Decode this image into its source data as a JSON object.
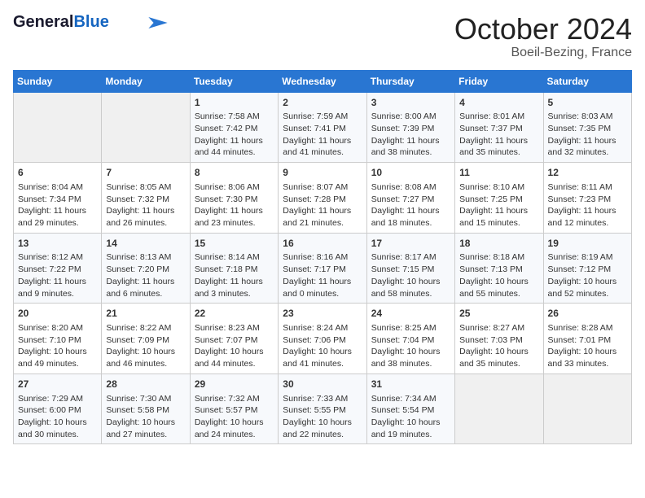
{
  "header": {
    "logo_general": "General",
    "logo_blue": "Blue",
    "month_title": "October 2024",
    "location": "Boeil-Bezing, France"
  },
  "columns": [
    "Sunday",
    "Monday",
    "Tuesday",
    "Wednesday",
    "Thursday",
    "Friday",
    "Saturday"
  ],
  "weeks": [
    [
      {
        "day": "",
        "info": ""
      },
      {
        "day": "",
        "info": ""
      },
      {
        "day": "1",
        "info": "Sunrise: 7:58 AM\nSunset: 7:42 PM\nDaylight: 11 hours and 44 minutes."
      },
      {
        "day": "2",
        "info": "Sunrise: 7:59 AM\nSunset: 7:41 PM\nDaylight: 11 hours and 41 minutes."
      },
      {
        "day": "3",
        "info": "Sunrise: 8:00 AM\nSunset: 7:39 PM\nDaylight: 11 hours and 38 minutes."
      },
      {
        "day": "4",
        "info": "Sunrise: 8:01 AM\nSunset: 7:37 PM\nDaylight: 11 hours and 35 minutes."
      },
      {
        "day": "5",
        "info": "Sunrise: 8:03 AM\nSunset: 7:35 PM\nDaylight: 11 hours and 32 minutes."
      }
    ],
    [
      {
        "day": "6",
        "info": "Sunrise: 8:04 AM\nSunset: 7:34 PM\nDaylight: 11 hours and 29 minutes."
      },
      {
        "day": "7",
        "info": "Sunrise: 8:05 AM\nSunset: 7:32 PM\nDaylight: 11 hours and 26 minutes."
      },
      {
        "day": "8",
        "info": "Sunrise: 8:06 AM\nSunset: 7:30 PM\nDaylight: 11 hours and 23 minutes."
      },
      {
        "day": "9",
        "info": "Sunrise: 8:07 AM\nSunset: 7:28 PM\nDaylight: 11 hours and 21 minutes."
      },
      {
        "day": "10",
        "info": "Sunrise: 8:08 AM\nSunset: 7:27 PM\nDaylight: 11 hours and 18 minutes."
      },
      {
        "day": "11",
        "info": "Sunrise: 8:10 AM\nSunset: 7:25 PM\nDaylight: 11 hours and 15 minutes."
      },
      {
        "day": "12",
        "info": "Sunrise: 8:11 AM\nSunset: 7:23 PM\nDaylight: 11 hours and 12 minutes."
      }
    ],
    [
      {
        "day": "13",
        "info": "Sunrise: 8:12 AM\nSunset: 7:22 PM\nDaylight: 11 hours and 9 minutes."
      },
      {
        "day": "14",
        "info": "Sunrise: 8:13 AM\nSunset: 7:20 PM\nDaylight: 11 hours and 6 minutes."
      },
      {
        "day": "15",
        "info": "Sunrise: 8:14 AM\nSunset: 7:18 PM\nDaylight: 11 hours and 3 minutes."
      },
      {
        "day": "16",
        "info": "Sunrise: 8:16 AM\nSunset: 7:17 PM\nDaylight: 11 hours and 0 minutes."
      },
      {
        "day": "17",
        "info": "Sunrise: 8:17 AM\nSunset: 7:15 PM\nDaylight: 10 hours and 58 minutes."
      },
      {
        "day": "18",
        "info": "Sunrise: 8:18 AM\nSunset: 7:13 PM\nDaylight: 10 hours and 55 minutes."
      },
      {
        "day": "19",
        "info": "Sunrise: 8:19 AM\nSunset: 7:12 PM\nDaylight: 10 hours and 52 minutes."
      }
    ],
    [
      {
        "day": "20",
        "info": "Sunrise: 8:20 AM\nSunset: 7:10 PM\nDaylight: 10 hours and 49 minutes."
      },
      {
        "day": "21",
        "info": "Sunrise: 8:22 AM\nSunset: 7:09 PM\nDaylight: 10 hours and 46 minutes."
      },
      {
        "day": "22",
        "info": "Sunrise: 8:23 AM\nSunset: 7:07 PM\nDaylight: 10 hours and 44 minutes."
      },
      {
        "day": "23",
        "info": "Sunrise: 8:24 AM\nSunset: 7:06 PM\nDaylight: 10 hours and 41 minutes."
      },
      {
        "day": "24",
        "info": "Sunrise: 8:25 AM\nSunset: 7:04 PM\nDaylight: 10 hours and 38 minutes."
      },
      {
        "day": "25",
        "info": "Sunrise: 8:27 AM\nSunset: 7:03 PM\nDaylight: 10 hours and 35 minutes."
      },
      {
        "day": "26",
        "info": "Sunrise: 8:28 AM\nSunset: 7:01 PM\nDaylight: 10 hours and 33 minutes."
      }
    ],
    [
      {
        "day": "27",
        "info": "Sunrise: 7:29 AM\nSunset: 6:00 PM\nDaylight: 10 hours and 30 minutes."
      },
      {
        "day": "28",
        "info": "Sunrise: 7:30 AM\nSunset: 5:58 PM\nDaylight: 10 hours and 27 minutes."
      },
      {
        "day": "29",
        "info": "Sunrise: 7:32 AM\nSunset: 5:57 PM\nDaylight: 10 hours and 24 minutes."
      },
      {
        "day": "30",
        "info": "Sunrise: 7:33 AM\nSunset: 5:55 PM\nDaylight: 10 hours and 22 minutes."
      },
      {
        "day": "31",
        "info": "Sunrise: 7:34 AM\nSunset: 5:54 PM\nDaylight: 10 hours and 19 minutes."
      },
      {
        "day": "",
        "info": ""
      },
      {
        "day": "",
        "info": ""
      }
    ]
  ]
}
